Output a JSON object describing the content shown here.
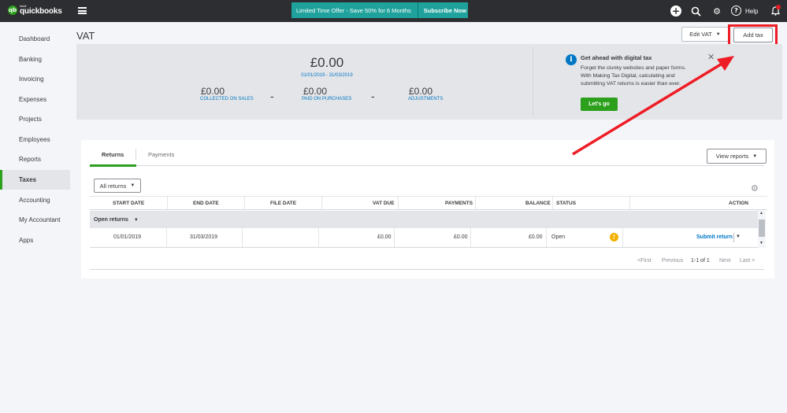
{
  "topbar": {
    "logo_intuit": "intuit",
    "logo_brand": "quickbooks",
    "promo_text": "Limited Time Offer - Save 50% for 6 Months",
    "promo_cta": "Subscribe Now",
    "help_label": "Help",
    "icons": [
      "plus-icon",
      "search-icon",
      "gear-icon",
      "help-icon",
      "bell-icon"
    ]
  },
  "sidebar": {
    "items": [
      {
        "label": "Dashboard"
      },
      {
        "label": "Banking"
      },
      {
        "label": "Invoicing"
      },
      {
        "label": "Expenses"
      },
      {
        "label": "Projects"
      },
      {
        "label": "Employees"
      },
      {
        "label": "Reports"
      },
      {
        "label": "Taxes",
        "active": true
      },
      {
        "label": "Accounting"
      },
      {
        "label": "My Accountant"
      },
      {
        "label": "Apps"
      }
    ]
  },
  "header": {
    "title": "VAT",
    "edit_vat": "Edit VAT",
    "add_tax": "Add tax"
  },
  "summary": {
    "total": "£0.00",
    "period": "01/01/2019 - 31/03/2019",
    "collected_amount": "£0.00",
    "collected_label": "COLLECTED ON SALES",
    "paid_amount": "£0.00",
    "paid_label": "PAID ON PURCHASES",
    "adjustments_amount": "£0.00",
    "adjustments_label": "ADJUSTMENTS",
    "minus": "-"
  },
  "promo_card": {
    "title": "Get ahead with digital tax",
    "lines": [
      "Forget the clunky websites and paper forms.",
      "With Making Tax Digital, calculating and",
      "submitting VAT returns is easier than ever."
    ],
    "cta": "Let's go"
  },
  "tabs": {
    "returns": "Returns",
    "payments": "Payments"
  },
  "toolbar": {
    "view_reports": "View reports",
    "filter": "All returns"
  },
  "table": {
    "headers": {
      "start_date": "START DATE",
      "end_date": "END DATE",
      "file_date": "FILE DATE",
      "vat_due": "VAT DUE",
      "payments": "PAYMENTS",
      "balance": "BALANCE",
      "status": "STATUS",
      "action": "ACTION"
    },
    "group_label": "Open returns",
    "rows": [
      {
        "start_date": "01/01/2019",
        "end_date": "31/03/2019",
        "file_date": "",
        "vat_due": "£0.00",
        "payments": "£0.00",
        "balance": "£0.00",
        "status": "Open",
        "action": "Submit return"
      }
    ]
  },
  "pager": {
    "first": "<First",
    "previous": "Previous",
    "range": "1-1 of 1",
    "next": "Next",
    "last": "Last >"
  },
  "colors": {
    "brand_green": "#2ca01c",
    "promo_teal": "#1fa29c",
    "link_blue": "#0077c5",
    "annotation_red": "#ee1c25",
    "warning": "#f2b000"
  }
}
